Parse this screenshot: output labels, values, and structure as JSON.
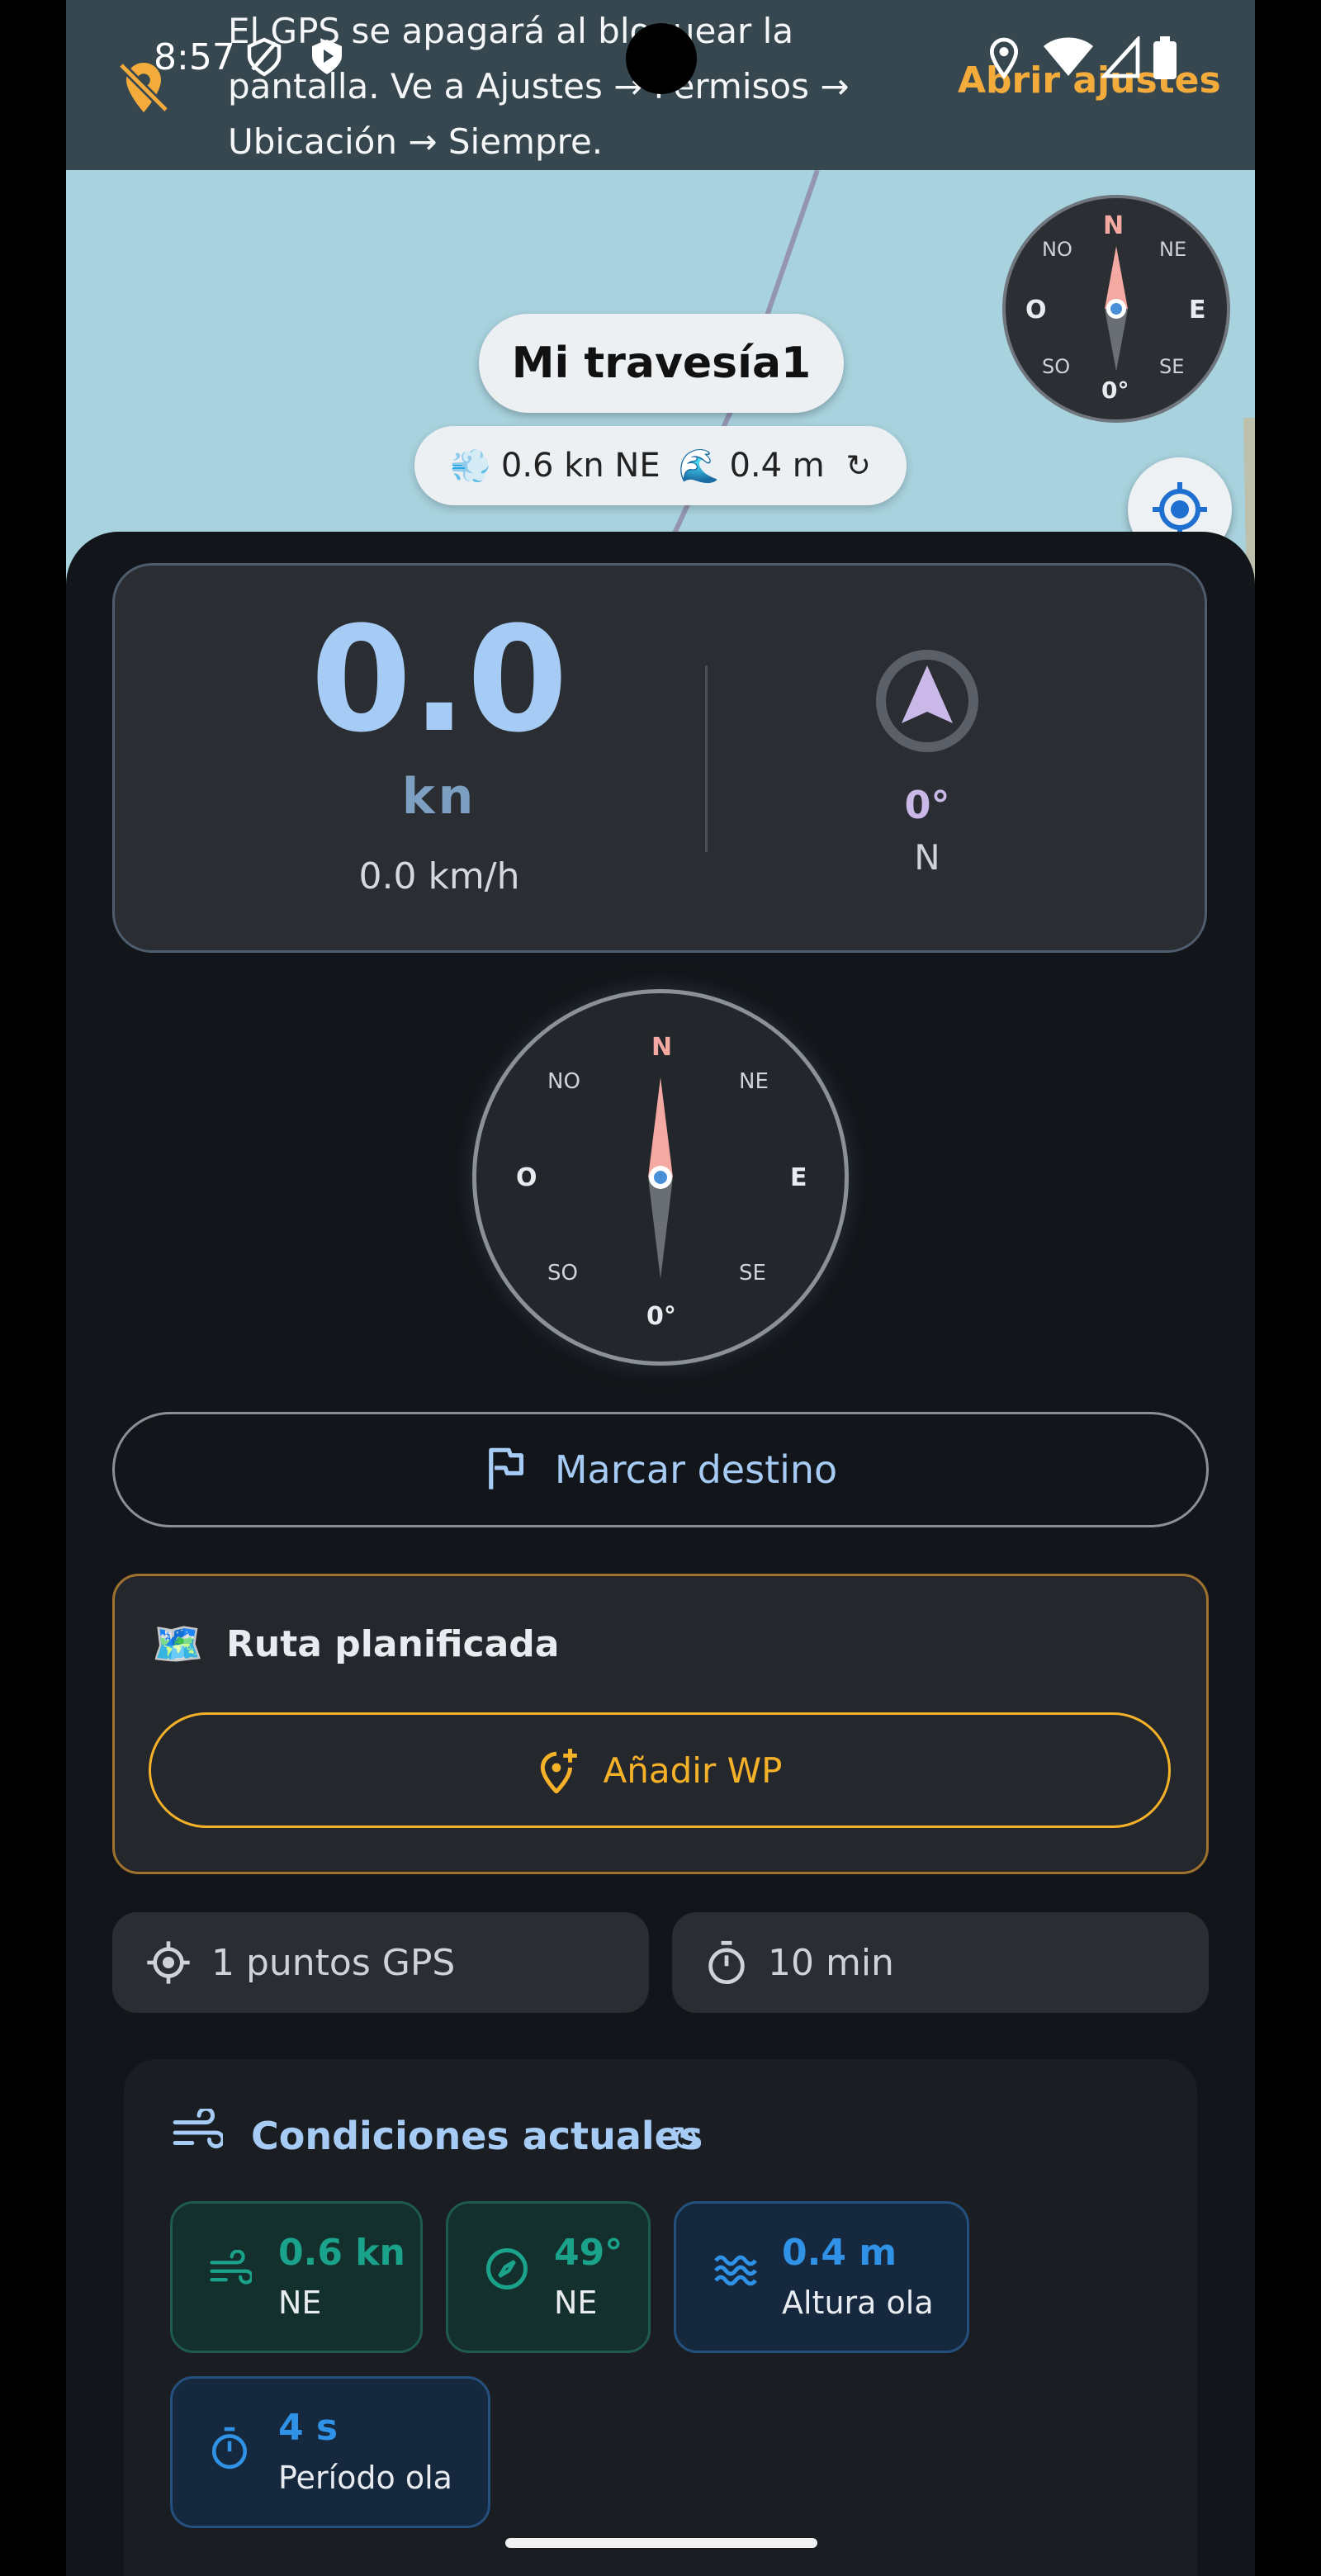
{
  "status_bar": {
    "time": "8:57"
  },
  "banner": {
    "message": "El GPS se apagará al bloquear la\npantalla. Ve a Ajustes → Permisos →\nUbicación → Siempre.",
    "action_label": "Abrir ajustes"
  },
  "map": {
    "trip_name": "Mi travesía1",
    "weather_pill": {
      "wind_emoji": "💨",
      "wind": "0.6 kn NE",
      "wave_emoji": "🌊",
      "wave": "0.4 m",
      "refresh": "↻"
    },
    "mini_compass": {
      "n": "N",
      "ne": "NE",
      "e": "E",
      "se": "SE",
      "s": "0°",
      "so": "SO",
      "o": "O",
      "no": "NO"
    }
  },
  "speed": {
    "value": "0.0",
    "unit": "kn",
    "kmh": "0.0 km/h"
  },
  "heading": {
    "degrees": "0°",
    "direction": "N"
  },
  "compass": {
    "n": "N",
    "ne": "NE",
    "e": "E",
    "se": "SE",
    "s": "0°",
    "so": "SO",
    "o": "O",
    "no": "NO"
  },
  "mark_destination": {
    "label": "Marcar destino"
  },
  "planned_route": {
    "emoji": "🗺️",
    "title": "Ruta planificada",
    "add_wp_label": "Añadir WP"
  },
  "chips": {
    "gps_points": "1 puntos GPS",
    "duration": "10 min"
  },
  "conditions": {
    "title": "Condiciones actuales",
    "refresh": "↻",
    "tiles": [
      {
        "value": "0.6 kn",
        "label": "NE"
      },
      {
        "value": "49°",
        "label": "NE"
      },
      {
        "value": "0.4 m",
        "label": "Altura ola"
      },
      {
        "value": "4 s",
        "label": "Período ola"
      }
    ]
  },
  "colors": {
    "accent_blue": "#a6ccf6",
    "accent_orange": "#f5b228",
    "tile_green": "#1aa38a",
    "tile_blue": "#2f92e6",
    "compass_needle": "#f4a9a2"
  }
}
